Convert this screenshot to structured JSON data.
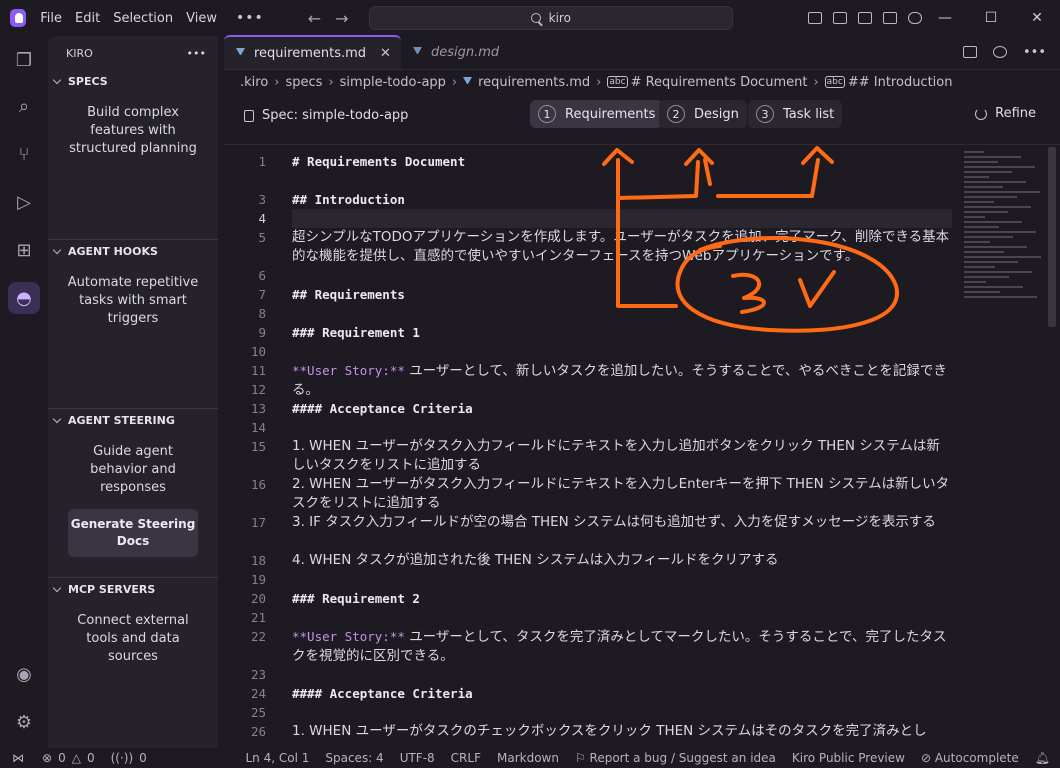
{
  "titlebar": {
    "menu": [
      "File",
      "Edit",
      "Selection",
      "View"
    ],
    "more": "•••",
    "search": "kiro",
    "window_controls": [
      "—",
      "☐",
      "✕"
    ]
  },
  "sidebar": {
    "title": "KIRO",
    "more": "•••",
    "sections": [
      {
        "title": "SPECS",
        "desc": "Build complex features with structured planning"
      },
      {
        "title": "AGENT HOOKS",
        "desc": "Automate repetitive tasks with smart triggers"
      },
      {
        "title": "AGENT STEERING",
        "desc": "Guide agent behavior and responses",
        "button": "Generate Steering Docs"
      },
      {
        "title": "MCP SERVERS",
        "desc": "Connect external tools and data sources"
      }
    ]
  },
  "tabs": [
    {
      "label": "requirements.md",
      "close": "✕"
    },
    {
      "label": "design.md"
    }
  ],
  "breadcrumb": [
    ".kiro",
    "specs",
    "simple-todo-app",
    "requirements.md",
    "# Requirements Document",
    "## Introduction"
  ],
  "spec": {
    "label": "Spec: simple-todo-app",
    "phases": [
      {
        "num": "1",
        "label": "Requirements"
      },
      {
        "num": "2",
        "label": "Design"
      },
      {
        "num": "3",
        "label": "Task list"
      }
    ],
    "refine": "Refine"
  },
  "code_lines": [
    {
      "n": "1",
      "text": "# Requirements Document",
      "kind": "h"
    },
    {
      "n": "",
      "text": "",
      "kind": ""
    },
    {
      "n": "3",
      "text": "## Introduction",
      "kind": "h"
    },
    {
      "n": "4",
      "text": "",
      "kind": "cursor"
    },
    {
      "n": "5",
      "text": "超シンプルなTODOアプリケーションを作成します。ユーザーがタスクを追加、完了マーク、削除できる基本的な機能を提供し、直感的で使いやすいインターフェースを持つWebアプリケーションです。",
      "kind": "jp"
    },
    {
      "n": "6",
      "text": "",
      "kind": ""
    },
    {
      "n": "7",
      "text": "## Requirements",
      "kind": "h"
    },
    {
      "n": "8",
      "text": "",
      "kind": ""
    },
    {
      "n": "9",
      "text": "### Requirement 1",
      "kind": "h"
    },
    {
      "n": "10",
      "text": "",
      "kind": ""
    },
    {
      "n": "11",
      "text": "ユーザーとして、新しいタスクを追加したい。そうすることで、やるべきことを記録できる。",
      "kind": "story",
      "prefix": "**User Story:**"
    },
    {
      "n": "12",
      "text": "",
      "kind": ""
    },
    {
      "n": "13",
      "text": "#### Acceptance Criteria",
      "kind": "h"
    },
    {
      "n": "14",
      "text": "",
      "kind": ""
    },
    {
      "n": "15",
      "text": "1. WHEN ユーザーがタスク入力フィールドにテキストを入力し追加ボタンをクリック THEN システムは新しいタスクをリストに追加する",
      "kind": "jp"
    },
    {
      "n": "16",
      "text": "2. WHEN ユーザーがタスク入力フィールドにテキストを入力しEnterキーを押下 THEN システムは新しいタスクをリストに追加する",
      "kind": "jp"
    },
    {
      "n": "17",
      "text": "3. IF タスク入力フィールドが空の場合 THEN システムは何も追加せず、入力を促すメッセージを表示する",
      "kind": "jp"
    },
    {
      "n": "18",
      "text": "4. WHEN タスクが追加された後 THEN システムは入力フィールドをクリアする",
      "kind": "jp"
    },
    {
      "n": "19",
      "text": "",
      "kind": ""
    },
    {
      "n": "20",
      "text": "### Requirement 2",
      "kind": "h"
    },
    {
      "n": "21",
      "text": "",
      "kind": ""
    },
    {
      "n": "22",
      "text": "ユーザーとして、タスクを完了済みとしてマークしたい。そうすることで、完了したタスクを視覚的に区別できる。",
      "kind": "story",
      "prefix": "**User Story:**"
    },
    {
      "n": "23",
      "text": "",
      "kind": ""
    },
    {
      "n": "24",
      "text": "#### Acceptance Criteria",
      "kind": "h"
    },
    {
      "n": "25",
      "text": "",
      "kind": ""
    },
    {
      "n": "26",
      "text": "1. WHEN ユーザーがタスクのチェックボックスをクリック THEN システムはそのタスクを完了済みとし",
      "kind": "jp"
    }
  ],
  "statusbar": {
    "left": [
      "0",
      "0",
      "0"
    ],
    "right": [
      "Ln 4, Col 1",
      "Spaces: 4",
      "UTF-8",
      "CRLF",
      "Markdown",
      "Report a bug / Suggest an idea",
      "Kiro Public Preview",
      "Autocomplete"
    ]
  },
  "colors": {
    "accent": "#8b5cf6",
    "annotation": "#ff6a14"
  },
  "annotation_text": "3↑"
}
